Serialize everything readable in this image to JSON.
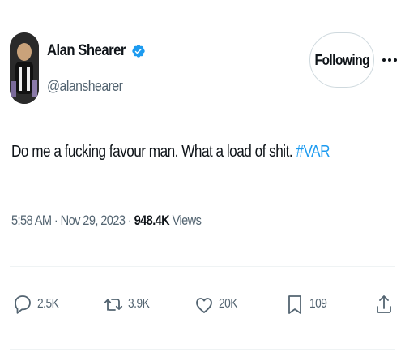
{
  "author": {
    "display_name": "Alan Shearer",
    "handle": "@alanshearer"
  },
  "follow_button": {
    "label": "Following"
  },
  "tweet": {
    "text": "Do me a fucking favour man. What a load of shit.",
    "hashtag": "#VAR"
  },
  "meta": {
    "time": "5:58 AM",
    "separator": "·",
    "date": "Nov 29, 2023",
    "views_count": "948.4K",
    "views_label": "Views"
  },
  "actions": {
    "replies": "2.5K",
    "reposts": "3.9K",
    "likes": "20K",
    "bookmarks": "109"
  },
  "icons": [
    "verified-badge-icon",
    "more-icon",
    "reply-icon",
    "repost-icon",
    "like-icon",
    "bookmark-icon",
    "share-icon"
  ],
  "colors": {
    "accent": "#1d9bf0",
    "text_primary": "#0f1419",
    "text_secondary": "#536471",
    "border": "#cfd9de"
  }
}
